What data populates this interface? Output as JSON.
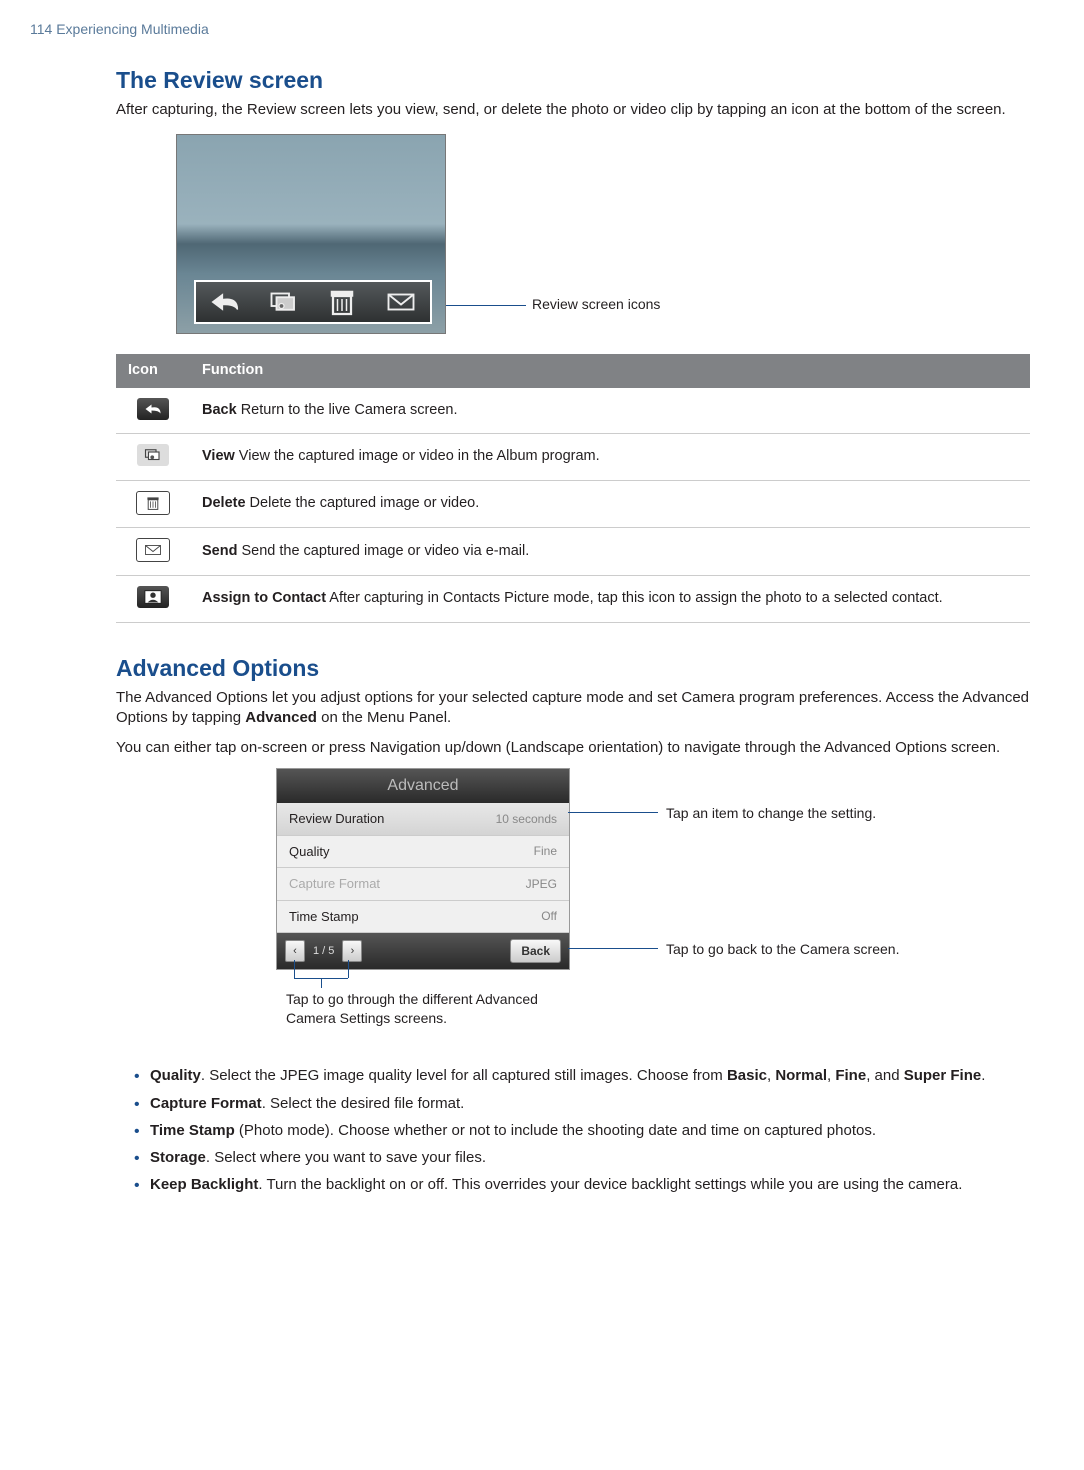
{
  "page_header": "114  Experiencing Multimedia",
  "section1": {
    "title": "The Review screen",
    "intro": "After capturing, the Review screen lets you view, send, or delete the photo or video clip by tapping an icon at the bottom of the screen.",
    "callout": "Review screen icons"
  },
  "table": {
    "header_icon": "Icon",
    "header_func": "Function",
    "rows": [
      {
        "name": "Back",
        "desc": "  Return to the live Camera screen."
      },
      {
        "name": "View",
        "desc": "  View the captured image or video in the Album program."
      },
      {
        "name": "Delete",
        "desc": "  Delete the captured image or video."
      },
      {
        "name": "Send",
        "desc": "  Send the captured image or video via e-mail."
      },
      {
        "name": "Assign to Contact",
        "desc": "  After capturing in Contacts Picture mode, tap this icon to assign the photo to a selected contact."
      }
    ]
  },
  "section2": {
    "title": "Advanced Options",
    "p1_before": "The Advanced Options let you adjust options for your selected capture mode and set Camera program preferences. Access the Advanced Options by tapping ",
    "p1_bold": "Advanced",
    "p1_after": " on the Menu Panel.",
    "p2": "You can either tap on-screen or press Navigation up/down (Landscape orientation) to navigate through the Advanced Options screen."
  },
  "adv": {
    "title": "Advanced",
    "rows": [
      {
        "label": "Review Duration",
        "value": "10 seconds",
        "class": "highlight"
      },
      {
        "label": "Quality",
        "value": "Fine",
        "class": ""
      },
      {
        "label": "Capture Format",
        "value": "JPEG",
        "class": "disabled"
      },
      {
        "label": "Time Stamp",
        "value": "Off",
        "class": ""
      }
    ],
    "pager_prev": "‹",
    "pager_text": "1 / 5",
    "pager_next": "›",
    "back": "Back",
    "callout_top": "Tap an item to change the setting.",
    "callout_right": "Tap to go back to the Camera screen.",
    "callout_bottom": "Tap to go through the different Advanced Camera Settings screens."
  },
  "bullets": {
    "quality_name": "Quality",
    "quality_t1": ". Select the JPEG image quality level for all captured still images. Choose from ",
    "quality_b1": "Basic",
    "quality_t2": ", ",
    "quality_b2": "Normal",
    "quality_t3": ", ",
    "quality_b3": "Fine",
    "quality_t4": ", and ",
    "quality_b4": "Super Fine",
    "quality_t5": ".",
    "capfmt_name": "Capture Format",
    "capfmt_rest": ". Select the desired file format.",
    "tstamp_name": "Time Stamp",
    "tstamp_rest": " (Photo mode). Choose whether or not to include the shooting date and time on captured photos.",
    "storage_name": "Storage",
    "storage_rest": ". Select where you want to save your files.",
    "backlight_name": "Keep Backlight",
    "backlight_rest": ". Turn the backlight on or off. This overrides your device backlight settings while you are using the camera."
  }
}
